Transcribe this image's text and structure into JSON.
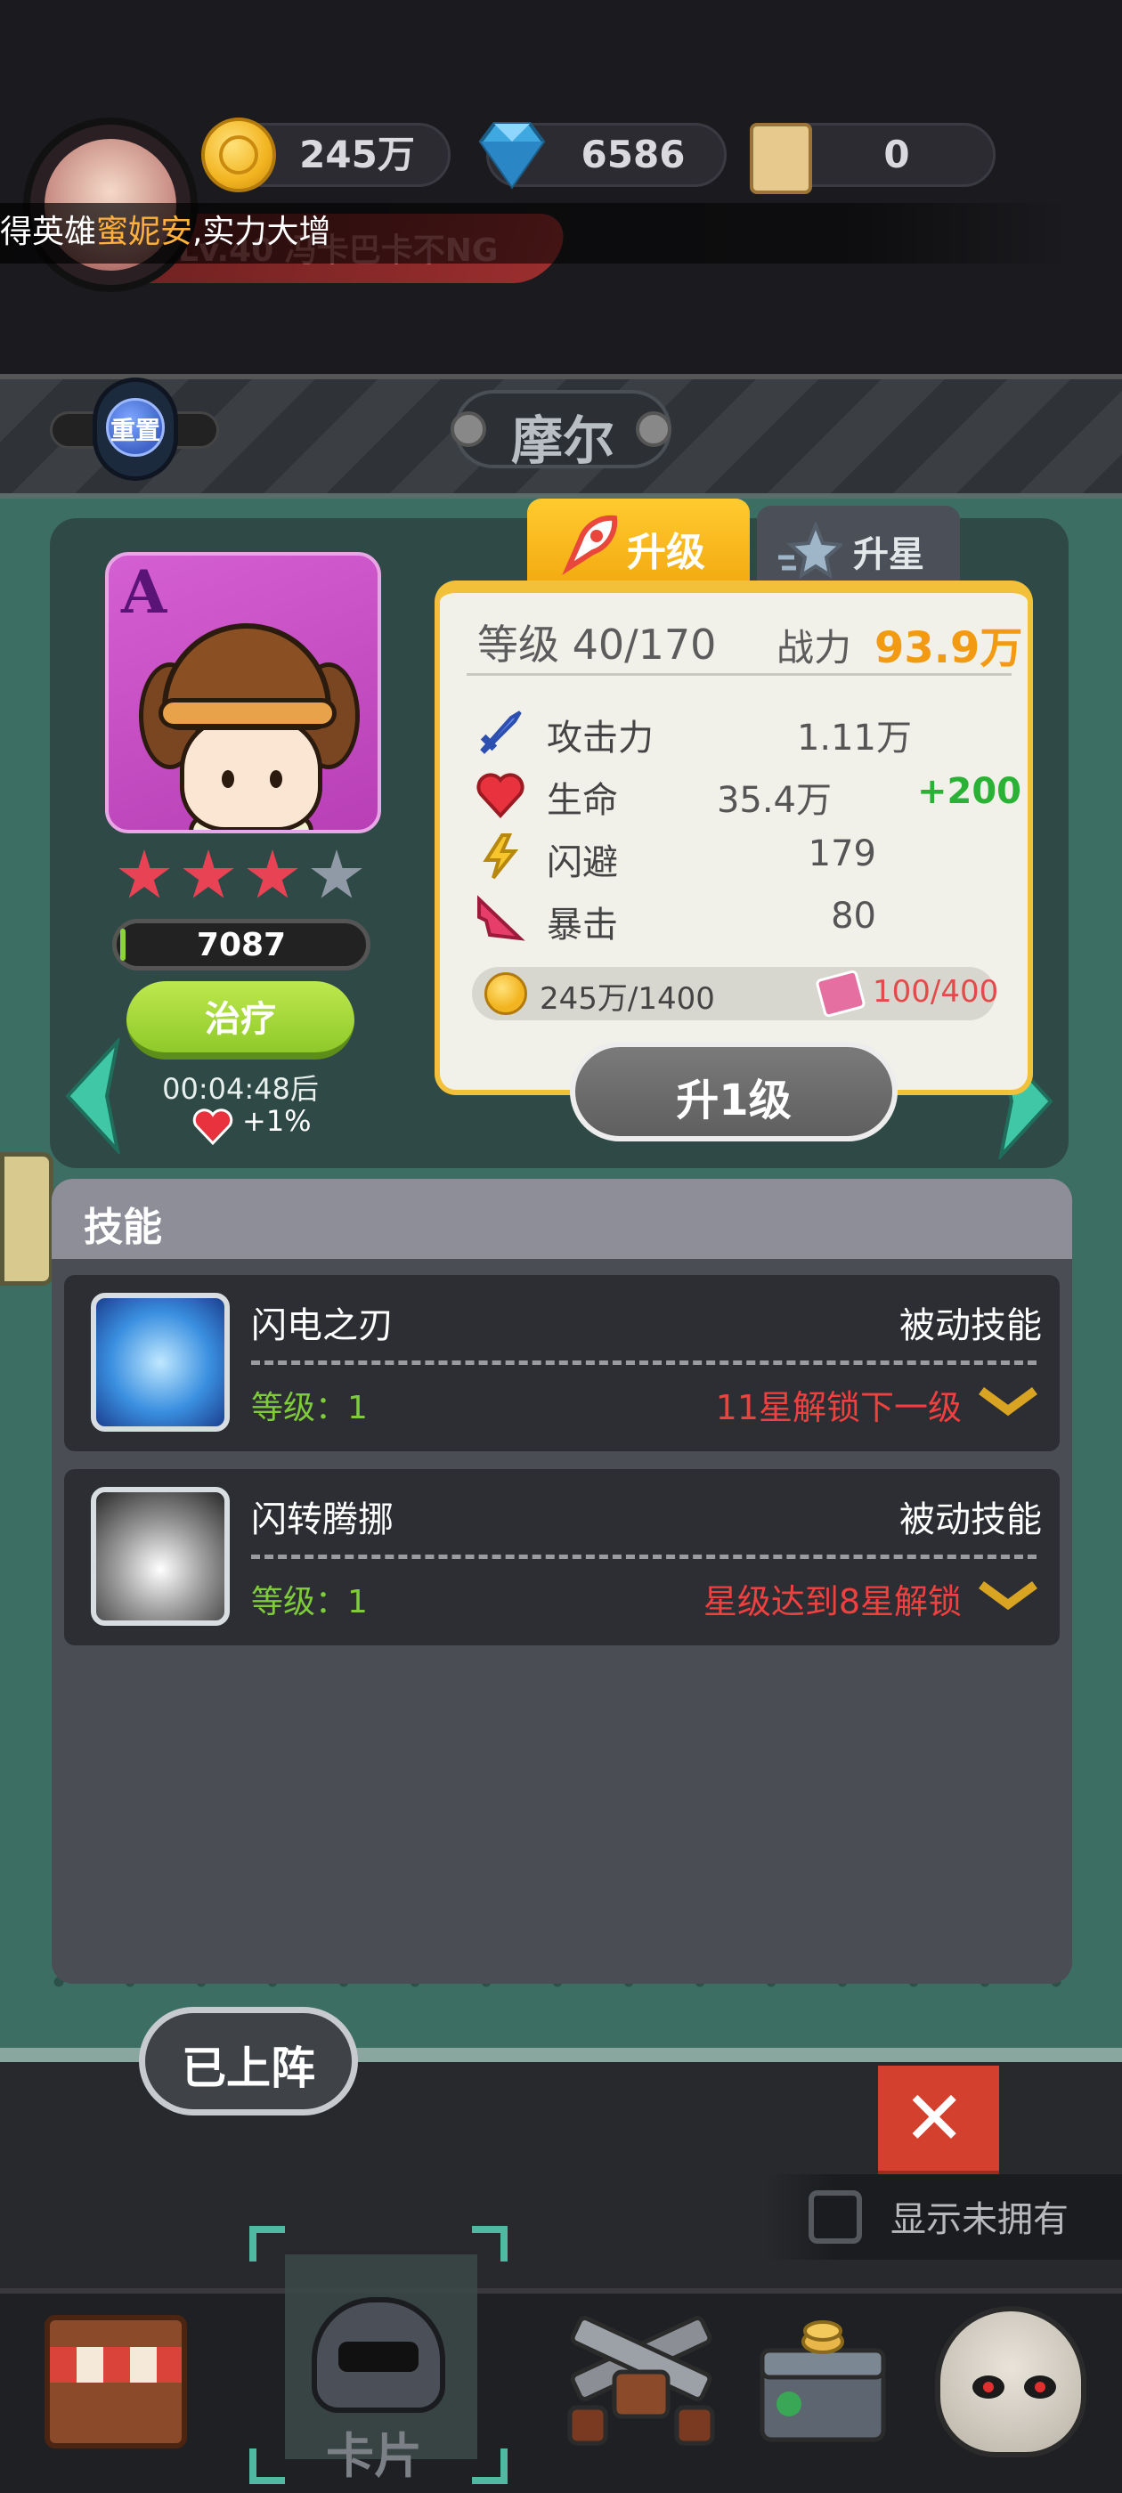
{
  "currency": {
    "gold": "245万",
    "diamonds": "6586",
    "scrolls": "0"
  },
  "player": {
    "name_banner": "Lv.40  冯卡巴卡不NG"
  },
  "notice": {
    "prefix": "得英雄",
    "highlight": "蜜妮安",
    "suffix": ",实力大增"
  },
  "header": {
    "reset_label": "重置",
    "hero_name": "摩尔"
  },
  "hero": {
    "rank": "A",
    "stars_filled": 3,
    "stars_total": 4,
    "hp": "7087",
    "heal_label": "治疗",
    "heal_timer": "00:04:48后",
    "heal_bonus": "+1%"
  },
  "tabs": {
    "upgrade": "升级",
    "star_up": "升星"
  },
  "stats": {
    "level": "等级 40/170",
    "power_label": "战力",
    "power_value": "93.9万",
    "rows": [
      {
        "label": "攻击力",
        "value": "1.11万",
        "bonus": ""
      },
      {
        "label": "生命",
        "value": "35.4万",
        "bonus": "+200"
      },
      {
        "label": "闪避",
        "value": "179",
        "bonus": ""
      },
      {
        "label": "暴击",
        "value": "80",
        "bonus": ""
      }
    ],
    "cost_gold": "245万/1400",
    "cost_exp": "100/400",
    "upgrade_button": "升1级"
  },
  "skills": {
    "title": "技能",
    "items": [
      {
        "name": "闪电之刃",
        "type": "被动技能",
        "level": "等级：1",
        "unlock": "11星解锁下一级"
      },
      {
        "name": "闪转腾挪",
        "type": "被动技能",
        "level": "等级：1",
        "unlock": "星级达到8星解锁"
      }
    ]
  },
  "footer": {
    "deploy_button": "已上阵",
    "show_unowned": "显示未拥有",
    "close_symbol": "✕"
  },
  "tabbar": {
    "card_label": "卡片"
  },
  "colors": {
    "accent_gold": "#f3c03a",
    "power": "#f29b12",
    "bonus_green": "#2bb236",
    "unlock_red": "#f0403f",
    "heal_green": "#8fc92a"
  }
}
